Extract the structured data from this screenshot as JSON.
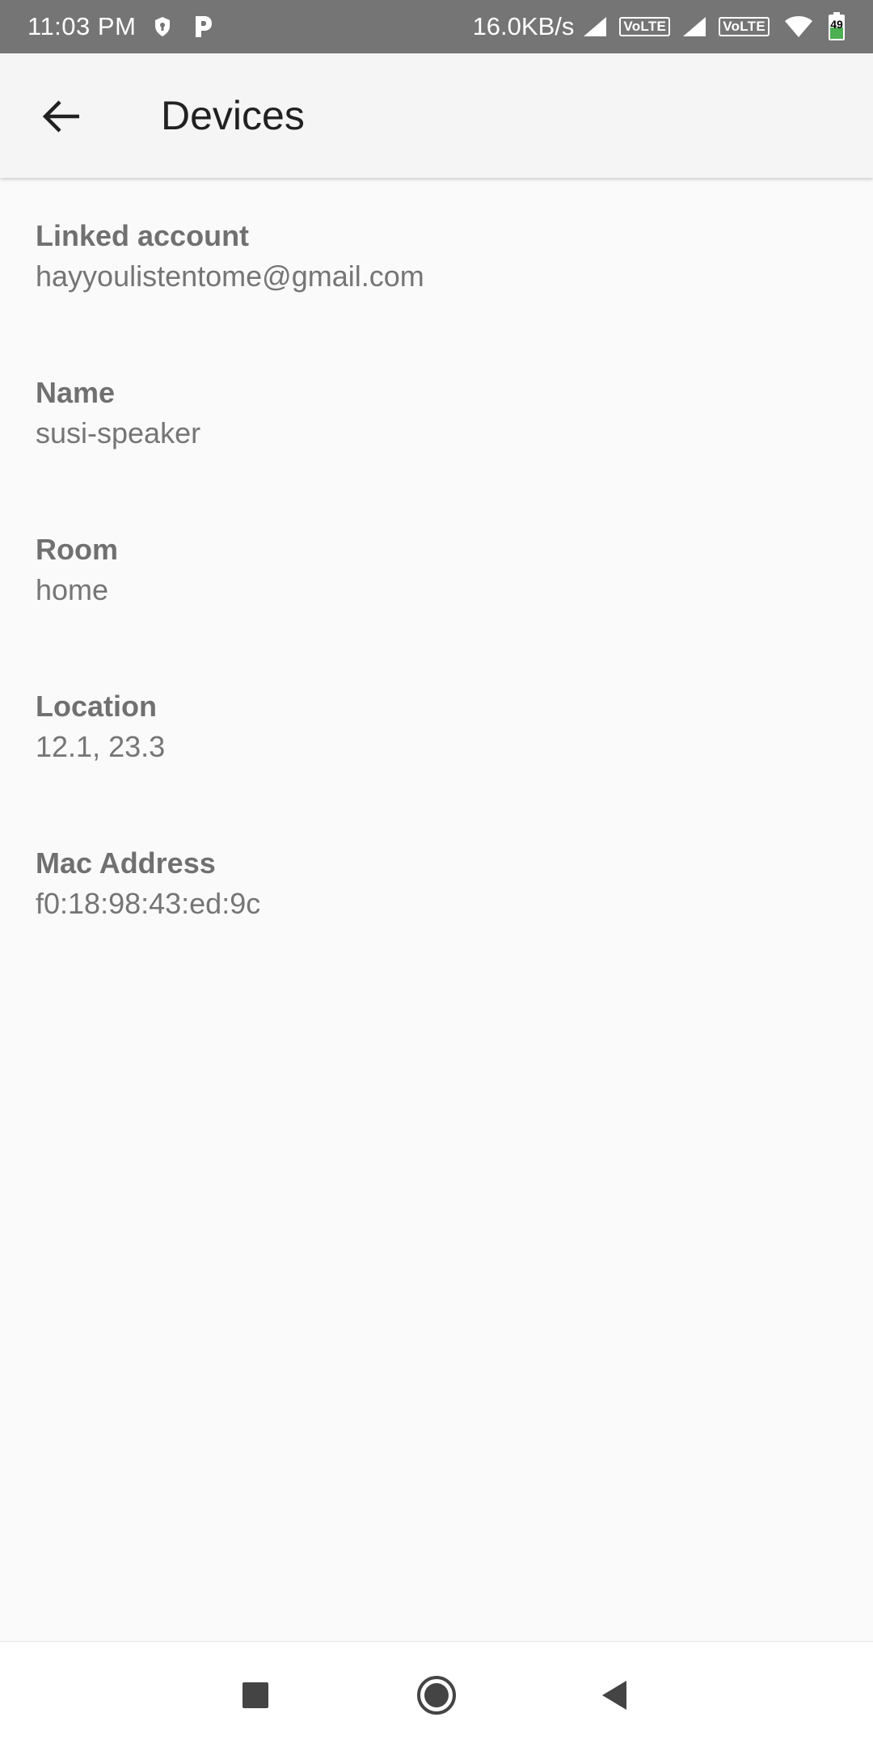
{
  "status_bar": {
    "time": "11:03 PM",
    "net_speed": "16.0KB/s",
    "volte_1": "VoLTE",
    "volte_2": "VoLTE",
    "battery": "49",
    "icons": [
      "shield-icon",
      "p-icon",
      "signal-icon",
      "wifi-icon",
      "battery-icon"
    ]
  },
  "app_bar": {
    "title": "Devices",
    "back_icon": "arrow-left-icon"
  },
  "details": [
    {
      "label": "Linked account",
      "value": "hayyoulistentome@gmail.com"
    },
    {
      "label": "Name",
      "value": "susi-speaker"
    },
    {
      "label": "Room",
      "value": "home"
    },
    {
      "label": "Location",
      "value": "12.1, 23.3"
    },
    {
      "label": "Mac Address",
      "value": "f0:18:98:43:ed:9c"
    }
  ],
  "nav_bar": {
    "icons": [
      "recents-square-icon",
      "home-circle-icon",
      "back-triangle-icon"
    ]
  }
}
